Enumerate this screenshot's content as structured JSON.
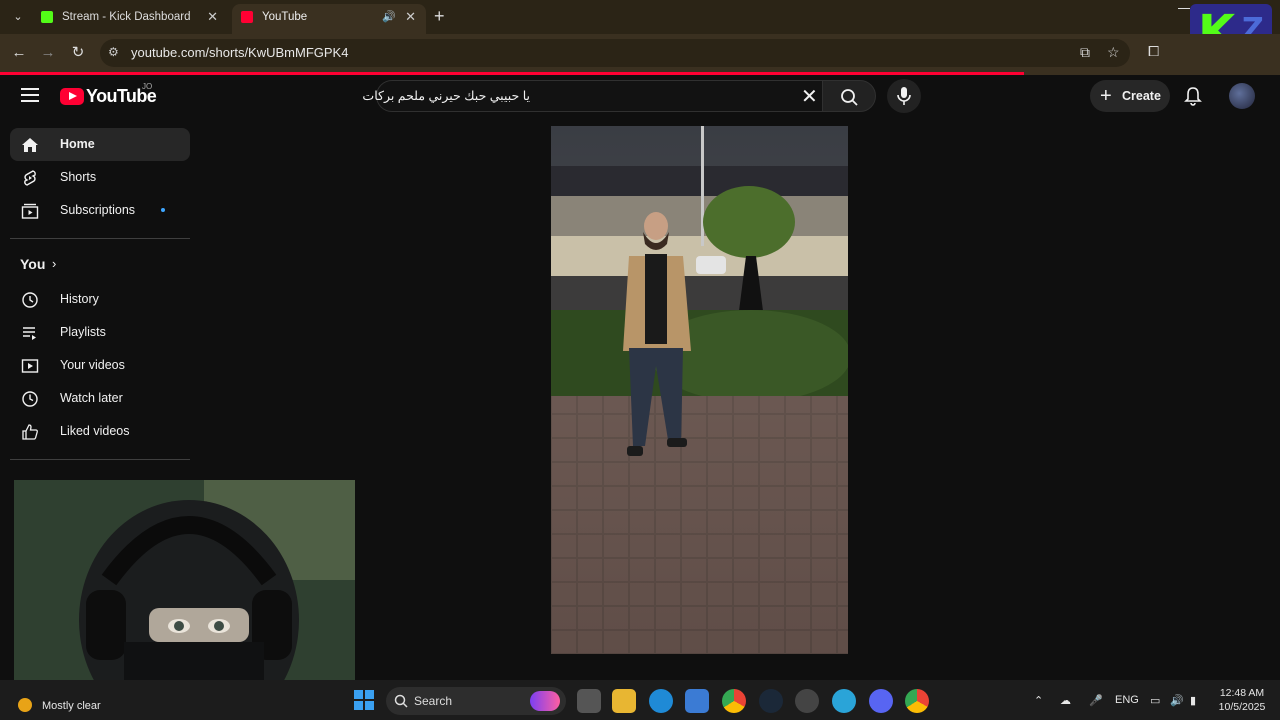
{
  "browser": {
    "tabs": [
      {
        "title": "Stream - Kick Dashboard",
        "favicon_color": "#53fc18"
      },
      {
        "title": "YouTube",
        "favicon_color": "#ff0033"
      }
    ],
    "url": "youtube.com/shorts/KwUBmMFGPK4",
    "overlay_logo": {
      "letter": "K",
      "suffix": "Z"
    }
  },
  "youtube": {
    "logo_text": "YouTube",
    "country_code": "JO",
    "search_query": "يا حبيبي حبك حيرني ملحم بركات",
    "create_label": "Create",
    "sidebar": {
      "main": [
        {
          "label": "Home",
          "icon": "home-icon"
        },
        {
          "label": "Shorts",
          "icon": "shorts-icon"
        },
        {
          "label": "Subscriptions",
          "icon": "subscriptions-icon"
        }
      ],
      "you_label": "You",
      "you_items": [
        {
          "label": "History",
          "icon": "history-icon"
        },
        {
          "label": "Playlists",
          "icon": "playlists-icon"
        },
        {
          "label": "Your videos",
          "icon": "your-videos-icon"
        },
        {
          "label": "Watch later",
          "icon": "watch-later-icon"
        },
        {
          "label": "Liked videos",
          "icon": "liked-videos-icon"
        }
      ]
    }
  },
  "taskbar": {
    "weather": "Mostly clear",
    "search_label": "Search",
    "language": "ENG",
    "time": "12:48 AM",
    "date": "10/5/2025"
  },
  "colors": {
    "accent": "#ff0033",
    "kick_green": "#53fc18",
    "subs_dot": "#3ea6ff"
  }
}
